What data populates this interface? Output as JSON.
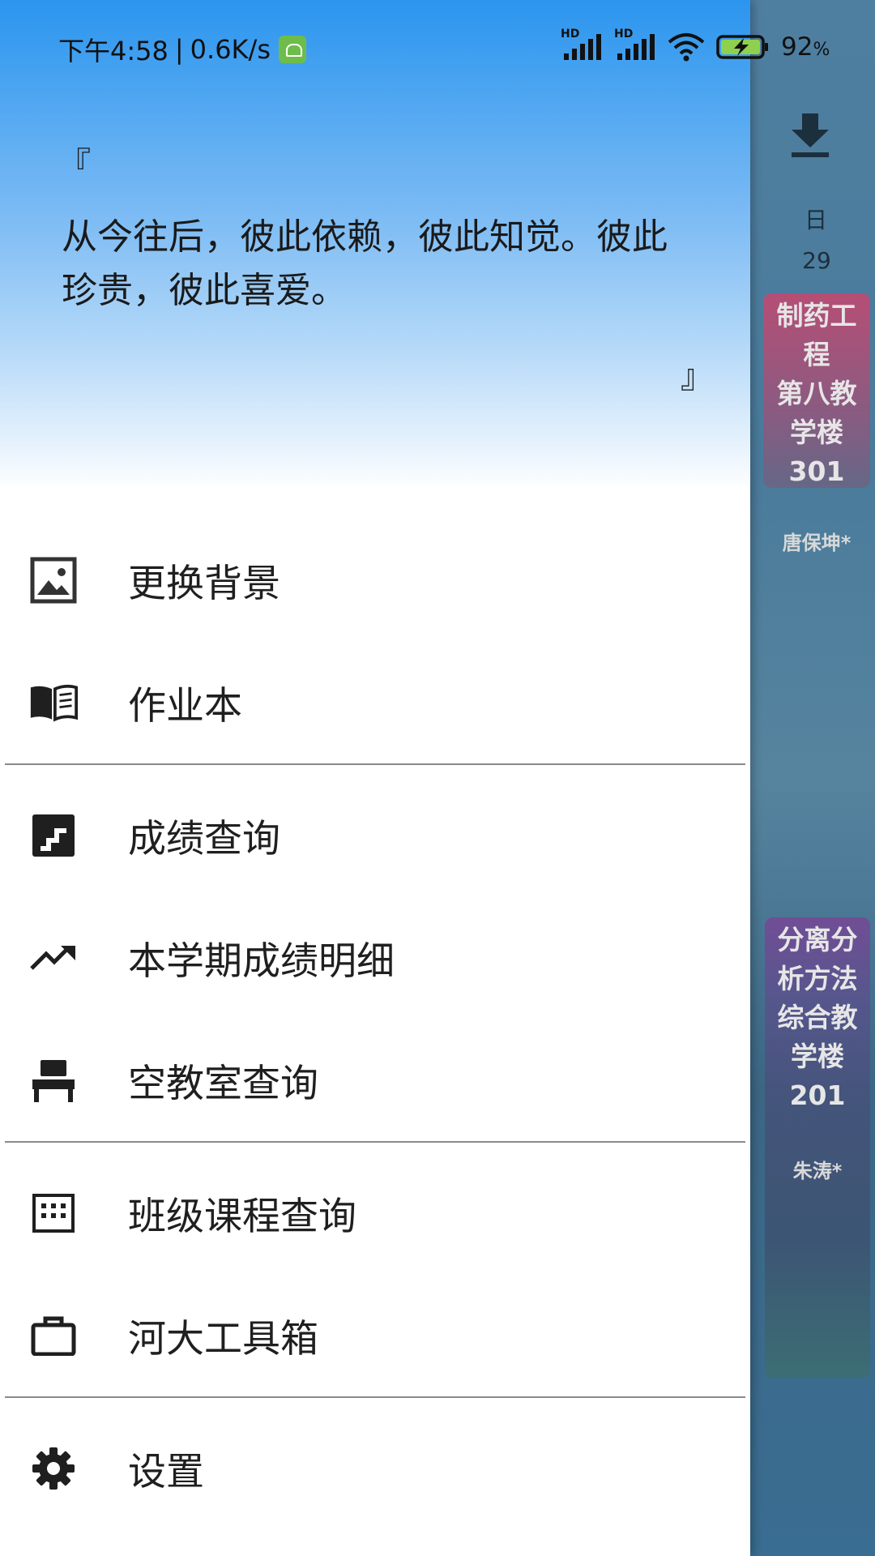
{
  "status_bar": {
    "time": "下午4:58",
    "separator": "|",
    "net_speed": "0.6K/s",
    "signal1_label": "HD",
    "signal2_label": "HD",
    "battery": "92",
    "battery_unit": "%"
  },
  "header": {
    "quote_open": "『",
    "quote_text": "从今往后，彼此依赖，彼此知觉。彼此珍贵，彼此喜爱。",
    "quote_close": "』"
  },
  "menu": {
    "items": [
      {
        "label": "更换背景",
        "icon": "image-icon"
      },
      {
        "label": "作业本",
        "icon": "book-icon"
      },
      {
        "label": "成绩查询",
        "icon": "stairs-icon"
      },
      {
        "label": "本学期成绩明细",
        "icon": "trending-up-icon"
      },
      {
        "label": "空教室查询",
        "icon": "chair-icon"
      },
      {
        "label": "班级课程查询",
        "icon": "calendar-grid-icon"
      },
      {
        "label": "河大工具箱",
        "icon": "briefcase-icon"
      },
      {
        "label": "设置",
        "icon": "gear-icon"
      }
    ]
  },
  "background_app": {
    "day_label": "日",
    "day_number": "29",
    "courses": [
      {
        "title": "制药工程",
        "location": "第八教学楼301",
        "title_lines": [
          "制药工",
          "程",
          "第八教",
          "学楼",
          "301"
        ],
        "teacher": "唐保坤*"
      },
      {
        "title": "分离分析方法",
        "location": "综合教学楼201",
        "title_lines": [
          "分离分",
          "析方法",
          "综合教",
          "学楼",
          "201"
        ],
        "teacher": "朱涛*"
      }
    ]
  },
  "colors": {
    "header_top": "#2b95ee",
    "header_bottom": "#ffffff",
    "divider": "#8a8a8a",
    "android_icon": "#6ebd4a"
  }
}
